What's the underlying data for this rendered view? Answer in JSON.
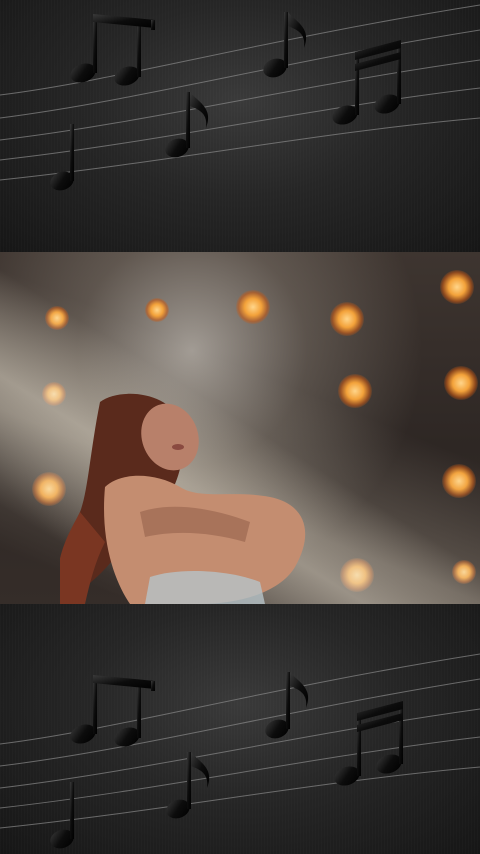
{
  "colors": {
    "background": "#262626",
    "notes": "#0c0c0c",
    "staff_lines": "#8a8a8a",
    "stage_lights": "#f3a23a"
  },
  "decor": {
    "top": {
      "icon": "music-notes-staff"
    },
    "bottom": {
      "icon": "music-notes-staff"
    }
  },
  "photo": {
    "subject": "dancer-under-stage-lights"
  }
}
